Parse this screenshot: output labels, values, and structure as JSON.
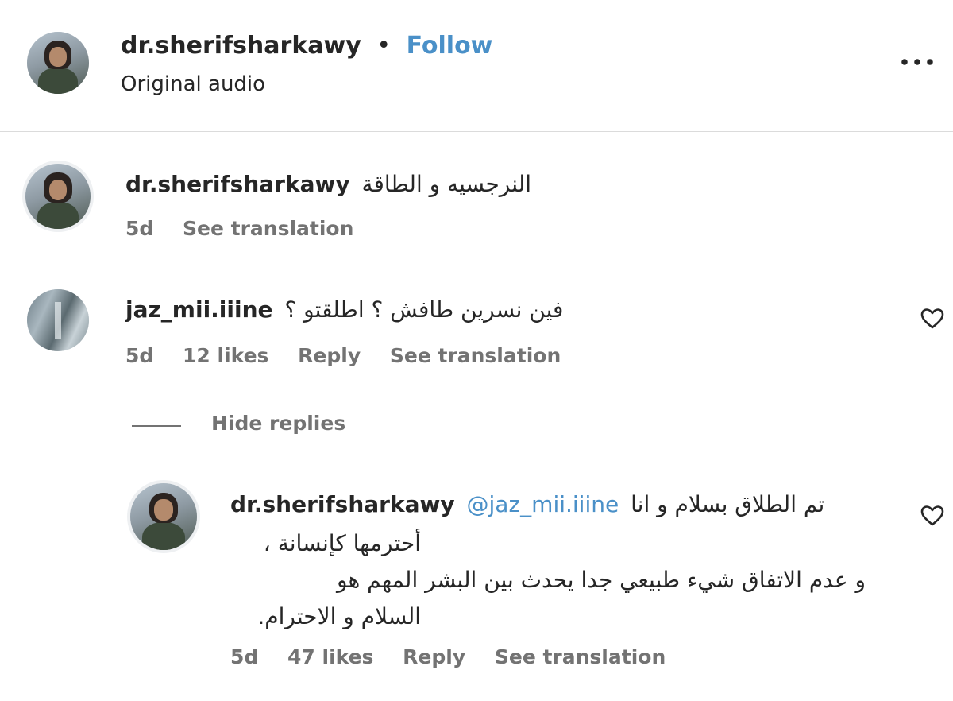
{
  "header": {
    "username": "dr.sherifsharkawy",
    "separator": "•",
    "follow_label": "Follow",
    "subtitle": "Original audio",
    "more_label": "•••"
  },
  "comments": [
    {
      "username": "dr.sherifsharkawy",
      "text": "النرجسيه و الطاقة",
      "age": "5d",
      "see_translation": "See translation"
    },
    {
      "username": "jaz_mii.iiine",
      "text": "فين نسرين طافش ؟ اطلقتو ؟",
      "age": "5d",
      "likes": "12 likes",
      "reply": "Reply",
      "see_translation": "See translation",
      "hide_replies": "Hide replies"
    }
  ],
  "reply": {
    "username": "dr.sherifsharkawy",
    "mention": "@jaz_mii.iiine",
    "line1": "تم الطلاق بسلام و انا",
    "line2": "أحترمها كإنسانة ،",
    "line3": "و عدم الاتفاق شيء طبيعي جدا يحدث بين البشر المهم هو",
    "line4": "السلام و الاحترام.",
    "age": "5d",
    "likes": "47 likes",
    "reply": "Reply",
    "see_translation": "See translation"
  },
  "colors": {
    "accent": "#4a90c8",
    "text": "#262626",
    "muted": "#737373",
    "divider": "#dbdbdb"
  }
}
